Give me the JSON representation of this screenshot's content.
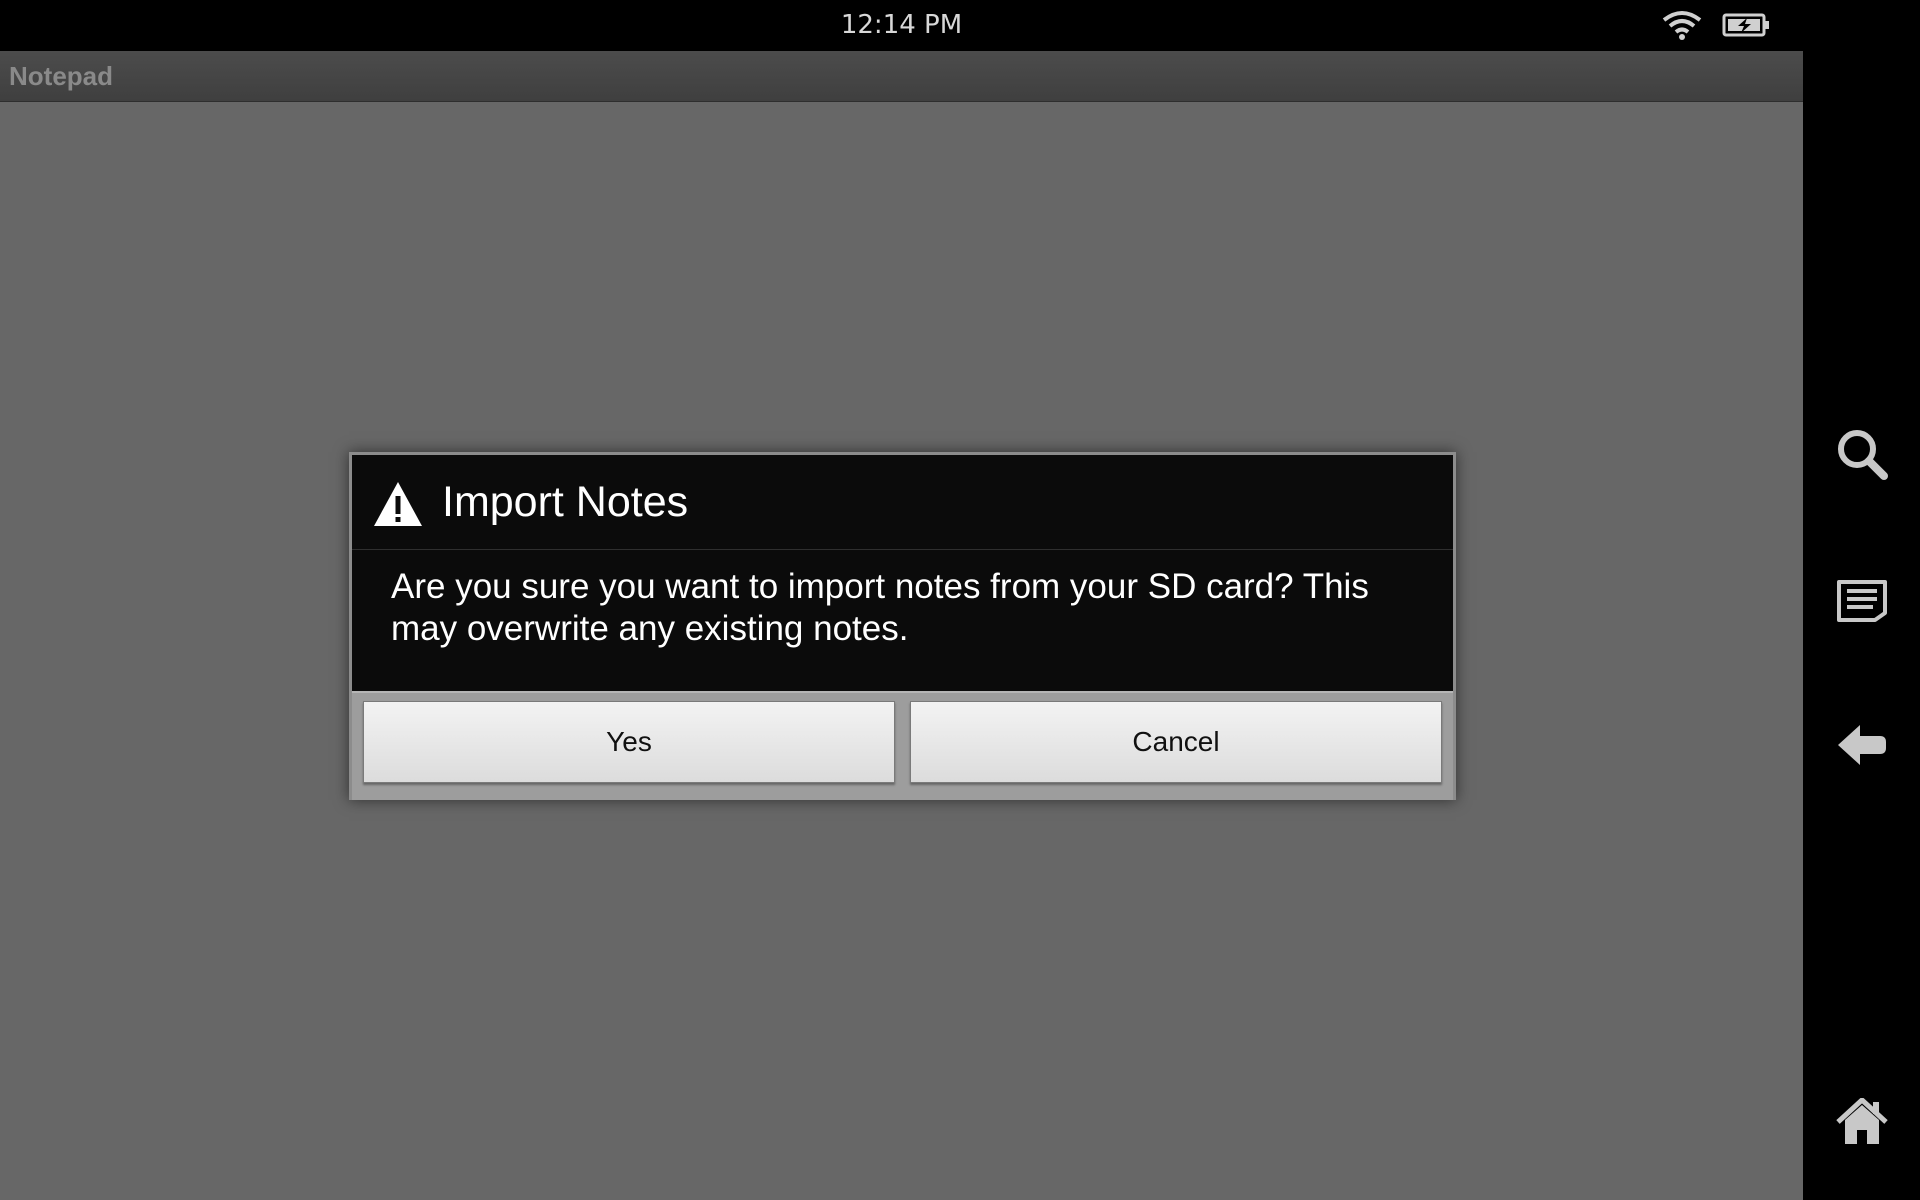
{
  "status_bar": {
    "time": "12:14 PM",
    "wifi_icon": "wifi-icon",
    "battery_icon": "battery-charging-icon"
  },
  "app": {
    "title": "Notepad"
  },
  "dialog": {
    "icon": "warning-icon",
    "title": "Import Notes",
    "message": "Are you sure you want to import notes from your SD card? This may overwrite any existing notes.",
    "yes_label": "Yes",
    "cancel_label": "Cancel"
  },
  "nav_bar": {
    "buttons": [
      "search-icon",
      "menu-icon",
      "back-icon",
      "home-icon"
    ]
  },
  "colors": {
    "background": "#676767",
    "dialog_background": "#0b0b0b",
    "status_bar": "#000000"
  }
}
